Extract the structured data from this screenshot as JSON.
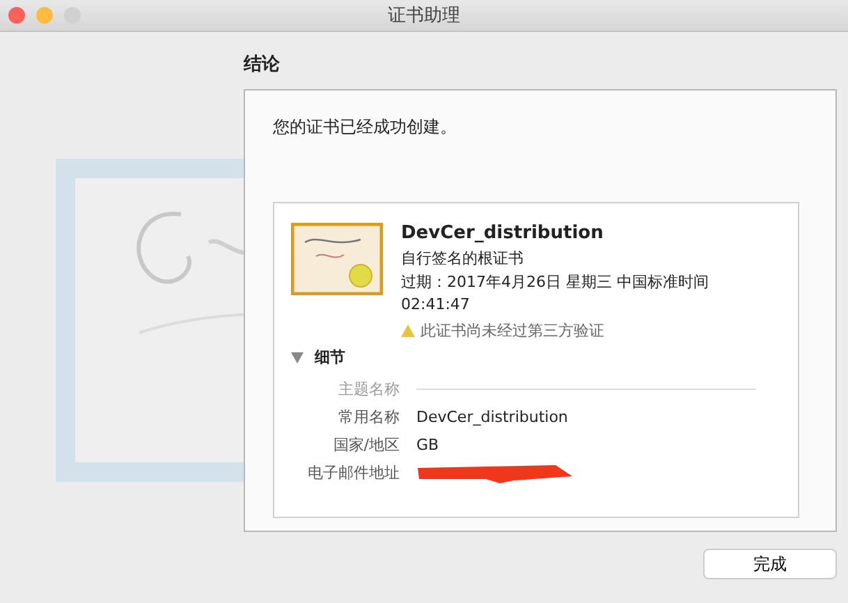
{
  "window": {
    "title": "证书助理"
  },
  "heading": "结论",
  "message": "您的证书已经成功创建。",
  "certificate": {
    "name": "DevCer_distribution",
    "type": "自行签名的根证书",
    "expiry": "过期：2017年4月26日 星期三 中国标准时间",
    "expiry_time": "02:41:47",
    "warning": "此证书尚未经过第三方验证"
  },
  "details": {
    "label": "细节",
    "expanded": true,
    "section": "主题名称",
    "rows": [
      {
        "label": "常用名称",
        "value": "DevCer_distribution",
        "redacted": false
      },
      {
        "label": "国家/地区",
        "value": "GB",
        "redacted": false
      },
      {
        "label": "电子邮件地址",
        "redacted": true
      }
    ]
  },
  "buttons": [
    "完成"
  ]
}
